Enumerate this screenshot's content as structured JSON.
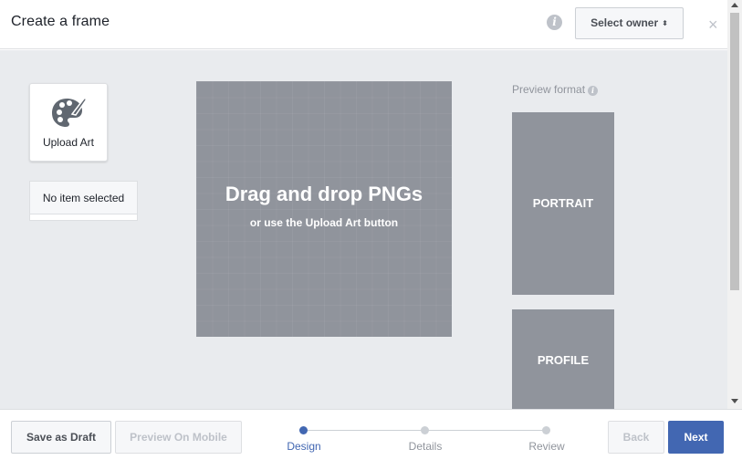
{
  "header": {
    "title": "Create a frame",
    "info_icon": "info-icon",
    "owner_button_label": "Select owner",
    "owner_caret": "⬍",
    "close_glyph": "×"
  },
  "sidebar": {
    "upload_label": "Upload Art",
    "upload_icon": "palette-icon",
    "no_item_label": "No item selected"
  },
  "dropzone": {
    "title": "Drag and drop PNGs",
    "subtitle": "or use the Upload Art button"
  },
  "preview": {
    "label": "Preview format",
    "formats": [
      "PORTRAIT",
      "PROFILE"
    ]
  },
  "footer": {
    "save_draft_label": "Save as Draft",
    "preview_mobile_label": "Preview On Mobile",
    "back_label": "Back",
    "next_label": "Next",
    "steps": [
      {
        "label": "Design",
        "active": true
      },
      {
        "label": "Details",
        "active": false
      },
      {
        "label": "Review",
        "active": false
      }
    ]
  },
  "colors": {
    "accent": "#4267b2",
    "canvas": "#90949c",
    "background": "#e9ebee"
  }
}
